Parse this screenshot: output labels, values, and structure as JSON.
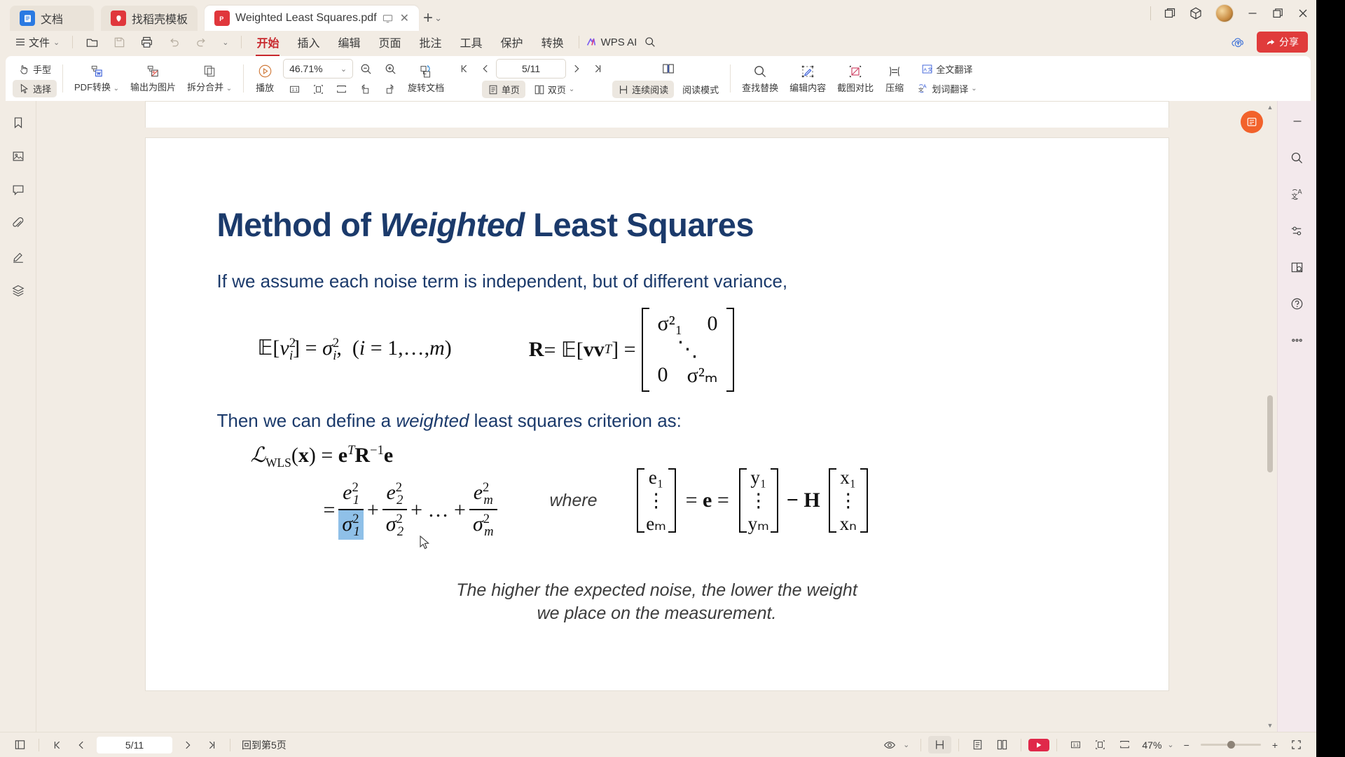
{
  "window": {
    "tabs": [
      {
        "label": "文档",
        "icon": "doc-icon",
        "active": false
      },
      {
        "label": "找稻壳模板",
        "icon": "dao-icon",
        "active": false
      },
      {
        "label": "Weighted Least Squares.pdf",
        "icon": "pdf-icon",
        "active": true
      }
    ],
    "new_tab": "+",
    "controls": {
      "restore_tabs": "restore-tabs-icon",
      "cube": "cube-icon",
      "avatar": "avatar",
      "minimize": "—",
      "maximize": "maximize-icon",
      "close": "✕"
    }
  },
  "menubar": {
    "file": "文件",
    "quick": [
      "open-icon",
      "save-icon",
      "print-icon",
      "undo-icon",
      "redo-icon",
      "chevron-down-icon"
    ],
    "tabs": [
      {
        "label": "开始",
        "active": true
      },
      {
        "label": "插入",
        "active": false
      },
      {
        "label": "编辑",
        "active": false
      },
      {
        "label": "页面",
        "active": false
      },
      {
        "label": "批注",
        "active": false
      },
      {
        "label": "工具",
        "active": false
      },
      {
        "label": "保护",
        "active": false
      },
      {
        "label": "转换",
        "active": false
      }
    ],
    "wps_ai": "WPS AI",
    "search": "search-icon",
    "cloud_upload": "cloud-upload-icon",
    "share": "分享"
  },
  "ribbon": {
    "hand_tool": "手型",
    "select_tool": "选择",
    "pdf_convert": "PDF转换",
    "export_image": "输出为图片",
    "split_merge": "拆分合并",
    "play": "播放",
    "zoom_value": "46.71%",
    "zoom_out": "zoom-out-icon",
    "zoom_in": "zoom-in-icon",
    "fit_actual": "1:1",
    "fit_page": "fit-page-icon",
    "fit_width": "fit-width-icon",
    "rotate_left": "rotate-left-icon",
    "rotate_right": "rotate-right-icon",
    "rotate_doc": "旋转文档",
    "single_page": "单页",
    "double_page": "双页",
    "continuous_read": "连续阅读",
    "read_mode": "阅读模式",
    "find_replace": "查找替换",
    "edit_content": "编辑内容",
    "screenshot_compare": "截图对比",
    "compress": "压缩",
    "full_translate": "全文翻译",
    "word_translate": "划词翻译",
    "first_page": "first-page-icon",
    "prev_page": "prev-page-icon",
    "next_page": "next-page-icon",
    "last_page": "last-page-icon",
    "page_indicator": "5/11"
  },
  "leftbar": {
    "items": [
      {
        "name": "bookmark-icon"
      },
      {
        "name": "thumbnail-icon"
      },
      {
        "name": "comment-icon"
      },
      {
        "name": "attachment-icon"
      },
      {
        "name": "signature-icon"
      },
      {
        "name": "layers-icon"
      }
    ]
  },
  "rightbar": {
    "collapse": "—",
    "items": [
      {
        "name": "search-icon"
      },
      {
        "name": "word-translate-icon"
      },
      {
        "name": "settings-sliders-icon"
      },
      {
        "name": "page-search-icon"
      },
      {
        "name": "help-icon"
      },
      {
        "name": "more-icon"
      }
    ]
  },
  "document": {
    "title_part1": "Method of ",
    "title_italic": "Weighted",
    "title_part2": " Least Squares",
    "intro": "If we assume each noise term is independent, but of different variance,",
    "eq1": {
      "lhs": "𝔼[v",
      "text": "𝔼[v²ᵢ] = σ²ᵢ,  (i = 1,…, m)"
    },
    "eq_R_label": "R = 𝔼[vvᵀ] =",
    "matrix_R": [
      "σ²₁",
      "0",
      "⋱",
      "0",
      "σ²ₘ"
    ],
    "then_line_a": "Then we can define a ",
    "then_italic": "weighted",
    "then_line_b": " least squares criterion as:",
    "wls_lhs": "ℒ",
    "wls_sub": "WLS",
    "wls_rest": "(x) = e",
    "where_label": "where",
    "vec_e": [
      "e₁",
      "⋮",
      "eₘ"
    ],
    "eq_e": "= e =",
    "vec_y": [
      "y₁",
      "⋮",
      "yₘ"
    ],
    "minus_H": "− H",
    "vec_x": [
      "x₁",
      "⋮",
      "xₙ"
    ],
    "caption_line1": "The higher the expected noise, the lower the weight",
    "caption_line2": "we place on the measurement."
  },
  "statusbar": {
    "sidebar_toggle": "panel-toggle-icon",
    "first": "first-page-icon",
    "prev": "prev-page-icon",
    "page": "5/11",
    "next": "next-page-icon",
    "last": "last-page-icon",
    "back_to_page": "回到第5页",
    "eye": "eye-icon",
    "continuous": "continuous-read-icon",
    "single": "single-page-icon",
    "double": "double-page-icon",
    "present": "present-icon",
    "actual_size": "actual-size-icon",
    "fit_page": "fit-page-icon",
    "fit_width": "fit-width-icon",
    "zoom": "47%",
    "zoom_minus": "−",
    "zoom_plus": "+",
    "fullscreen": "fullscreen-icon"
  },
  "colors": {
    "accent_red": "#c8282d",
    "share_red": "#e03b3b",
    "title_blue": "#1b3a6b",
    "selection_blue": "#8fc0e8",
    "chrome_bg": "#f2ece4"
  }
}
